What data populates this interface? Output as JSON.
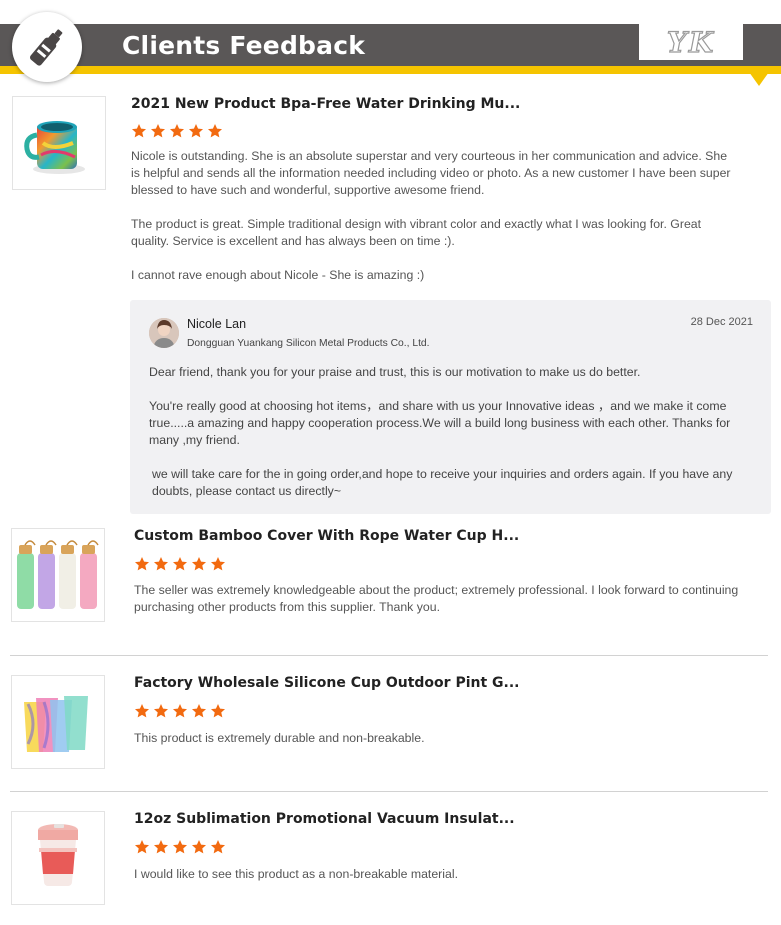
{
  "header": {
    "title": "Clients Feedback",
    "logo_text": "YK",
    "icon": "water-bottle-icon",
    "colors": {
      "banner": "#5a5757",
      "accent": "#f5c400",
      "star": "#f26a10"
    }
  },
  "reviews": [
    {
      "title": "2021 New Product Bpa-Free Water Drinking Mu...",
      "rating": 5,
      "paragraphs": [
        "Nicole is outstanding. She is an absolute superstar and very courteous in her communication and advice. She is helpful and sends all the information needed including video or photo. As a new customer I have been super blessed to have such and wonderful, supportive awesome friend.",
        "The product is great. Simple traditional design with vibrant color and exactly what I was looking for. Great quality. Service is excellent and has always been on time :).",
        "I cannot rave enough about Nicole -  She is amazing :)"
      ],
      "image": "rainbow-mug-image"
    },
    {
      "title": "Custom Bamboo Cover With Rope Water Cup H...",
      "rating": 5,
      "paragraphs": [
        "The seller was extremely knowledgeable about the product; extremely professional. I look forward to continuing purchasing other products from this supplier. Thank you."
      ],
      "image": "bamboo-bottles-image"
    },
    {
      "title": "Factory Wholesale Silicone Cup Outdoor Pint G...",
      "rating": 5,
      "paragraphs": [
        "This product is extremely durable and non-breakable."
      ],
      "image": "silicone-cups-image"
    },
    {
      "title": "12oz Sublimation Promotional Vacuum Insulat...",
      "rating": 5,
      "paragraphs": [
        "I would like to see this product as a non-breakable material."
      ],
      "image": "coffee-cup-image"
    }
  ],
  "reply": {
    "name": "Nicole Lan",
    "company": "Dongguan Yuankang Silicon Metal Products Co., Ltd.",
    "date": "28 Dec 2021",
    "paragraphs": [
      "Dear friend, thank you for your praise and trust, this is our motivation to make us do better.",
      "You're really good at choosing hot items，and share with us your Innovative ideas ，and we make it come true.....a amazing and happy cooperation process.We will a build long business with each other.  Thanks for many ,my friend.",
      "we will take care for the in going order,and hope to receive your inquiries and orders again. If you have any doubts, please contact us directly~"
    ]
  }
}
